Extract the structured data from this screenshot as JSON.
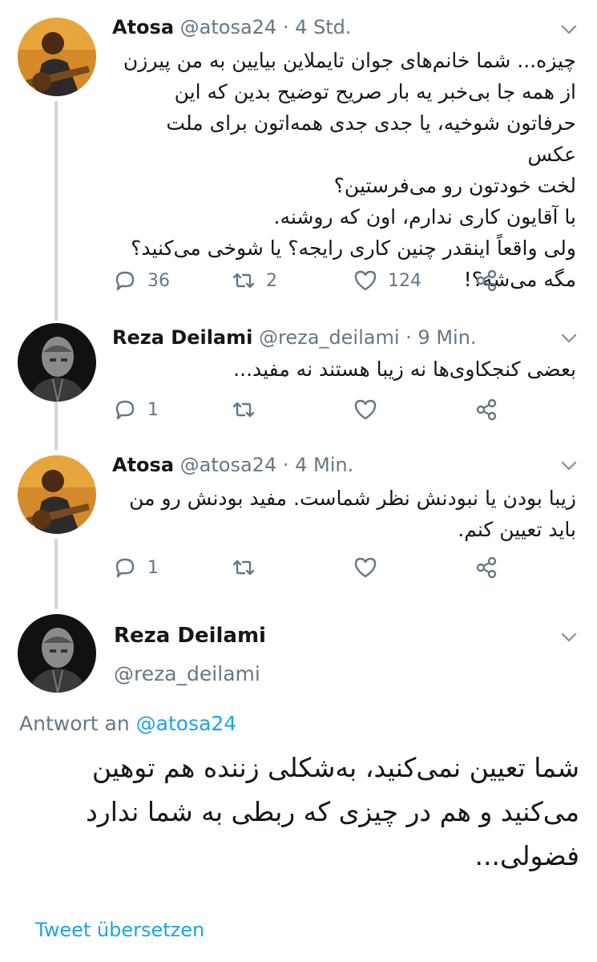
{
  "tweets": [
    {
      "name": "Atosa",
      "handle": "@atosa24",
      "separator": "·",
      "time": "4 Std.",
      "text": "چیزه... شما خانم‌های جوان تایملاین بیایین به من پیرزن\nاز همه جا بی‌خبر یه بار صریح توضیح بدین که این\nحرفاتون شوخیه، یا جدی جدی همه‌اتون برای ملت عکس\nلخت خودتون رو می‌فرستین؟\nبا آقایون کاری ندارم، اون که روشنه.\nولی واقعاً اینقدر چنین کاری رایجه؟ یا شوخی می‌کنید؟\nمگه می‌شه؟!",
      "replies": "36",
      "retweets": "2",
      "likes": "124",
      "icons": [
        "reply-icon",
        "retweet-icon",
        "like-icon",
        "share-icon"
      ]
    },
    {
      "name": "Reza Deilami",
      "handle": "@reza_deilami",
      "separator": "·",
      "time": "9 Min.",
      "text": "بعضی کنجکاوی‌ها نه زیبا هستند نه مفید...",
      "replies": "1",
      "retweets": "",
      "likes": ""
    },
    {
      "name": "Atosa",
      "handle": "@atosa24",
      "separator": "·",
      "time": "4 Min.",
      "text": "زیبا بودن یا نبودنش نظر شماست. مفید بودنش رو من\nباید تعیین کنم.",
      "replies": "1",
      "retweets": "",
      "likes": ""
    }
  ],
  "focused": {
    "name": "Reza Deilami",
    "handle": "@reza_deilami",
    "reply_prefix": "Antwort an",
    "reply_mention": "@atosa24",
    "text": "شما تعیین نمی‌کنید، به‌شکلی زننده هم توهین\nمی‌کنید و هم در چیزی که ربطی به شما ندارد\nفضولی...",
    "translate_label": "Tweet übersetzen"
  },
  "colors": {
    "accent": "#1da1f2",
    "muted": "#657786",
    "thread": "#ccd6dd"
  }
}
